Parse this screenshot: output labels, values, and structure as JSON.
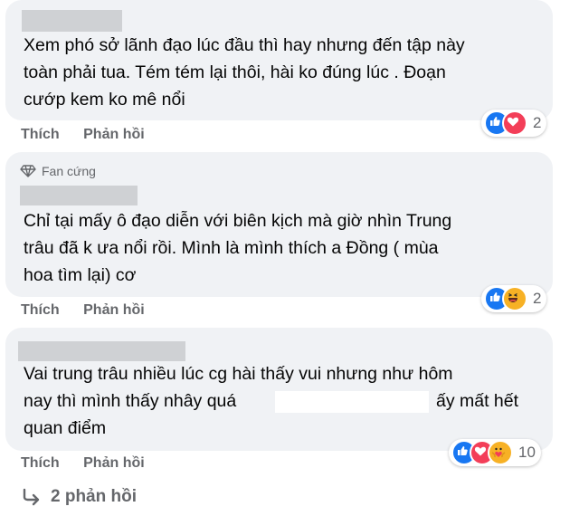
{
  "comments": [
    {
      "lines": [
        "Xem phó sở lãnh đạo lúc đầu thì hay nhưng đến tập này",
        "toàn phải tua. Tém tém lại thôi, hài ko đúng lúc . Đoạn",
        "cướp kem ko mê nổi"
      ],
      "reactions": [
        "like-icon",
        "love-icon"
      ],
      "reaction_count": "2",
      "like_label": "Thích",
      "reply_label": "Phản hồi"
    },
    {
      "badge": "Fan cứng",
      "lines": [
        "Chỉ tại mấy ô đạo diễn với biên kịch mà giờ nhìn Trung",
        "trâu đã k ưa nổi rồi. Mình là mình thích a Đồng ( mùa",
        "hoa tìm lại) cơ"
      ],
      "reactions": [
        "like-icon",
        "haha-icon"
      ],
      "reaction_count": "2",
      "like_label": "Thích",
      "reply_label": "Phản hồi"
    },
    {
      "lines": [
        "Vai trung trâu nhiều lúc cg hài thấy vui nhưng như hôm",
        "nay thì mình thấy nhây quá",
        "ấy mất hết",
        "quan điểm"
      ],
      "reactions": [
        "like-icon",
        "love-icon",
        "care-icon"
      ],
      "reaction_count": "10",
      "like_label": "Thích",
      "reply_label": "Phản hồi"
    }
  ],
  "more_replies": "2 phản hồi",
  "colors": {
    "bubble": "#f0f2f5",
    "muted": "#65676b",
    "like": "#1877f2",
    "love": "#f33e58",
    "haha": "#f7b125"
  }
}
